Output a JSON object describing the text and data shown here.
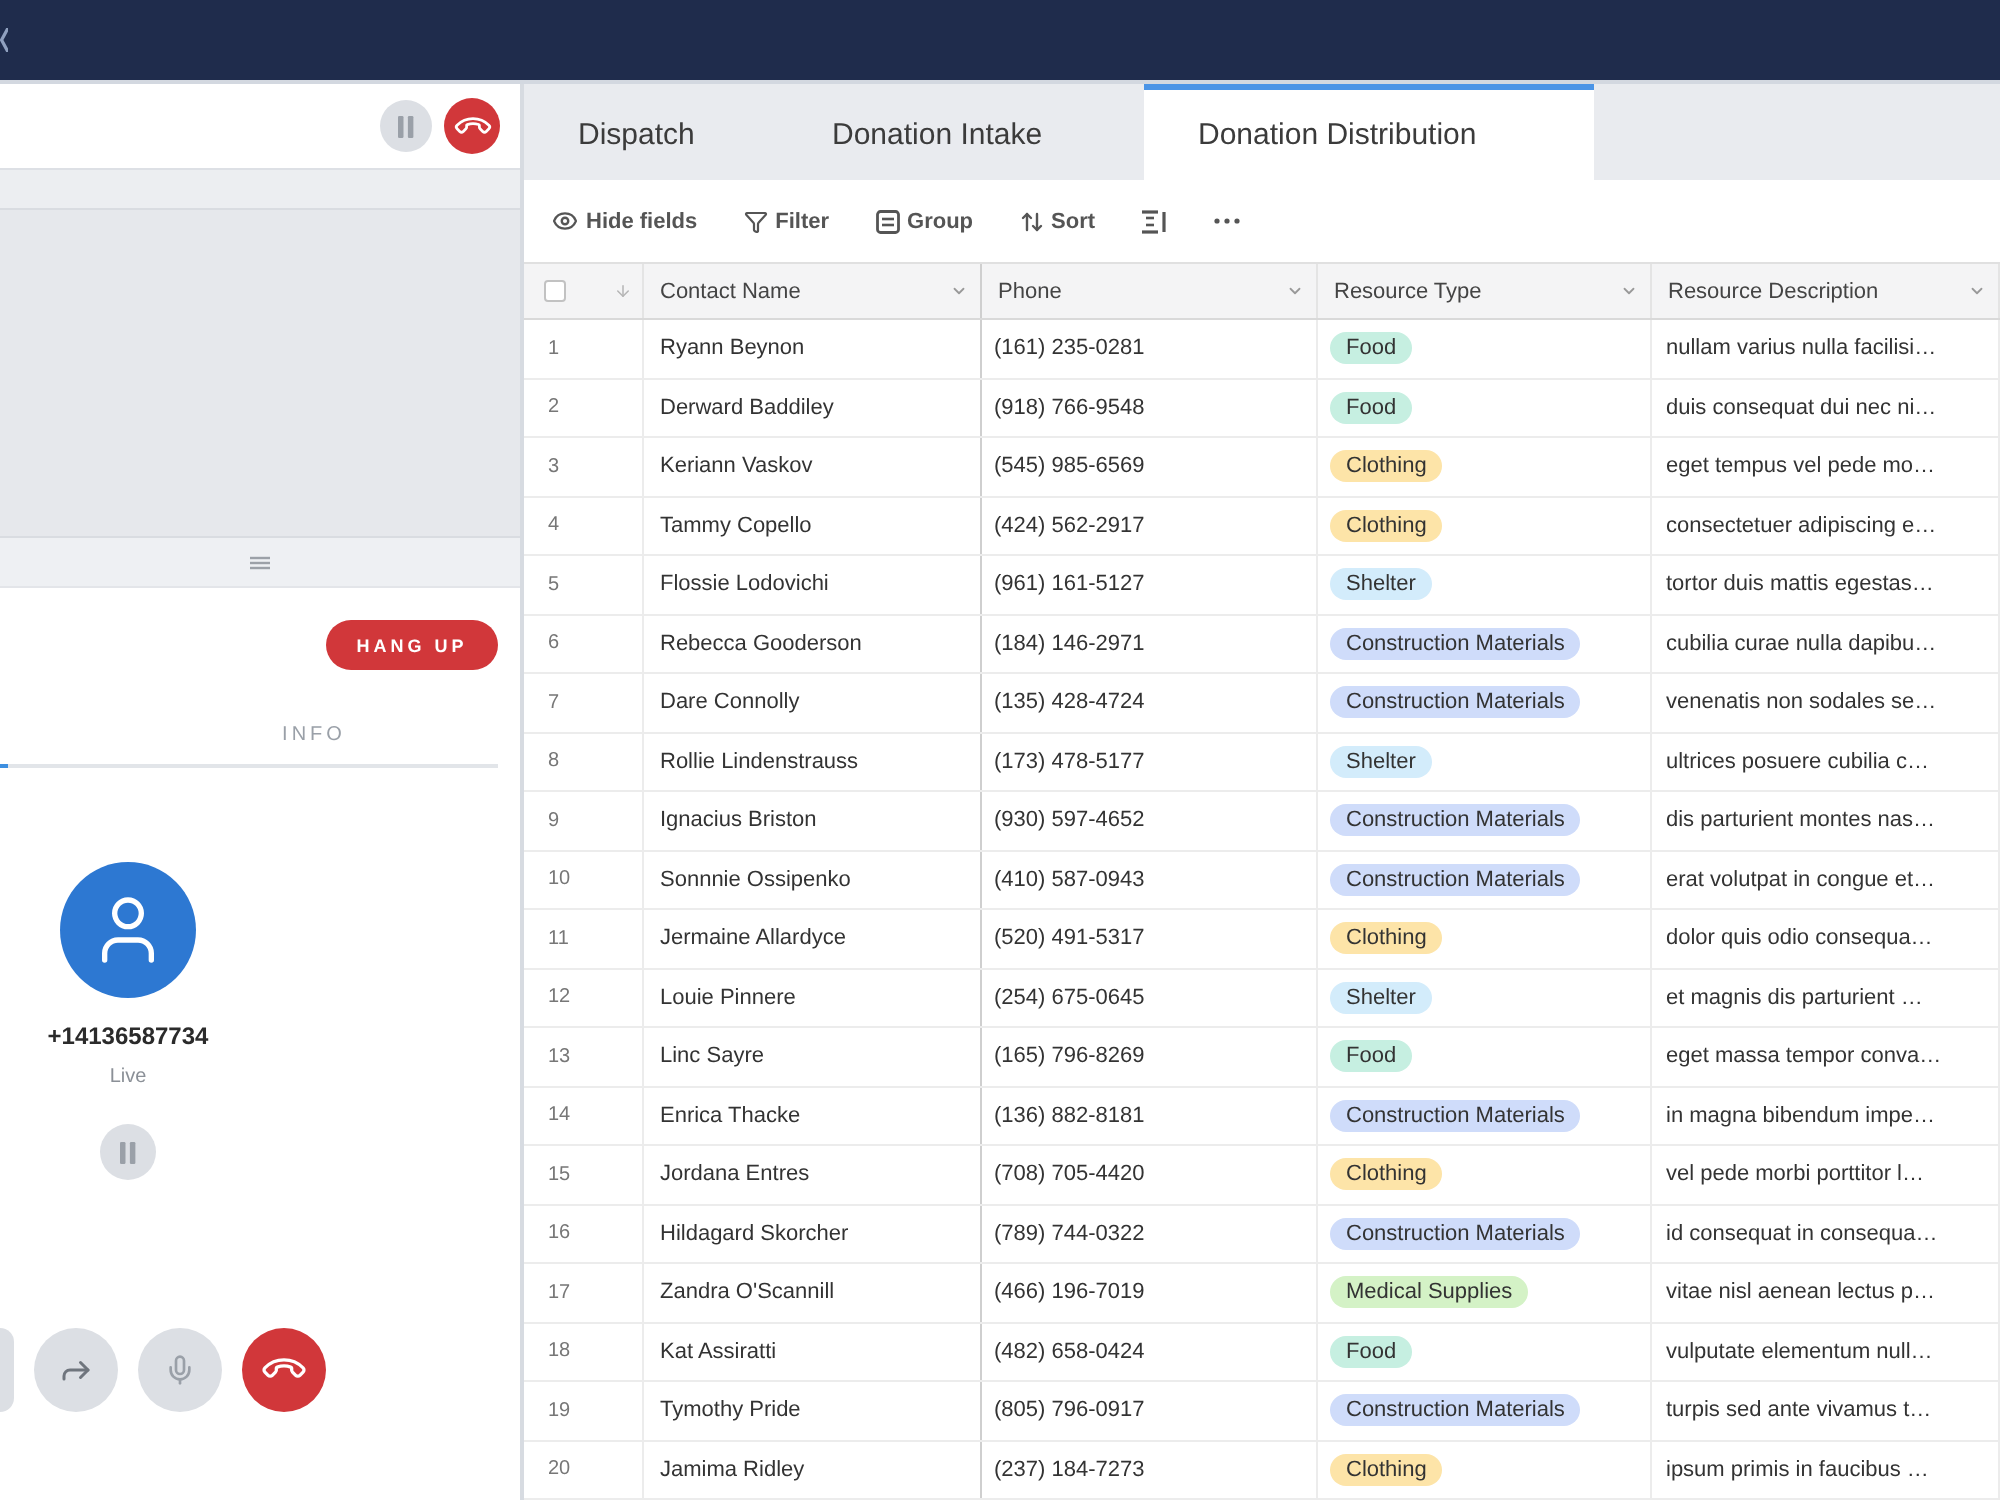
{
  "call_panel": {
    "hang_up_button": "HANG UP",
    "tabs": [
      {
        "selected": true
      },
      {
        "label": "INFO",
        "selected": false
      }
    ],
    "caller": {
      "number": "+14136587734",
      "status": "Live"
    }
  },
  "views": {
    "tabs": [
      {
        "label": "Dispatch",
        "selected": false
      },
      {
        "label": "Donation Intake",
        "selected": false
      },
      {
        "label": "Donation Distribution",
        "selected": true
      }
    ]
  },
  "toolbar": [
    {
      "kind": "hide",
      "label": "Hide fields"
    },
    {
      "kind": "filter",
      "label": "Filter"
    },
    {
      "kind": "group",
      "label": "Group"
    },
    {
      "kind": "sort",
      "label": "Sort"
    },
    {
      "kind": "row_height"
    },
    {
      "kind": "more"
    }
  ],
  "table": {
    "select_all": {
      "checked": false
    },
    "columns": [
      "Contact Name",
      "Phone",
      "Resource Type",
      "Resource Description"
    ],
    "rows": [
      {
        "number": "1",
        "contact_name": "Ryann Beynon",
        "phone": "(161) 235-0281",
        "resource_type": {
          "label": "Food",
          "color": "#c6efe1"
        },
        "resource_description": "nullam varius nulla facilisi…"
      },
      {
        "number": "2",
        "contact_name": "Derward Baddiley",
        "phone": "(918) 766-9548",
        "resource_type": {
          "label": "Food",
          "color": "#c6efe1"
        },
        "resource_description": "duis consequat dui nec ni…"
      },
      {
        "number": "3",
        "contact_name": "Keriann Vaskov",
        "phone": "(545) 985-6569",
        "resource_type": {
          "label": "Clothing",
          "color": "#fde4a8"
        },
        "resource_description": "eget tempus vel pede mo…"
      },
      {
        "number": "4",
        "contact_name": "Tammy Copello",
        "phone": "(424) 562-2917",
        "resource_type": {
          "label": "Clothing",
          "color": "#fde4a8"
        },
        "resource_description": "consectetuer adipiscing e…"
      },
      {
        "number": "5",
        "contact_name": "Flossie Lodovichi",
        "phone": "(961) 161-5127",
        "resource_type": {
          "label": "Shelter",
          "color": "#d3ecfb"
        },
        "resource_description": "tortor duis mattis egestas…"
      },
      {
        "number": "6",
        "contact_name": "Rebecca Gooderson",
        "phone": "(184) 146-2971",
        "resource_type": {
          "label": "Construction Materials",
          "color": "#cfdcfa"
        },
        "resource_description": "cubilia curae nulla dapibu…"
      },
      {
        "number": "7",
        "contact_name": "Dare Connolly",
        "phone": "(135) 428-4724",
        "resource_type": {
          "label": "Construction Materials",
          "color": "#cfdcfa"
        },
        "resource_description": "venenatis non sodales se…"
      },
      {
        "number": "8",
        "contact_name": "Rollie Lindenstrauss",
        "phone": "(173) 478-5177",
        "resource_type": {
          "label": "Shelter",
          "color": "#d3ecfb"
        },
        "resource_description": "ultrices posuere cubilia c…"
      },
      {
        "number": "9",
        "contact_name": "Ignacius Briston",
        "phone": "(930) 597-4652",
        "resource_type": {
          "label": "Construction Materials",
          "color": "#cfdcfa"
        },
        "resource_description": "dis parturient montes nas…"
      },
      {
        "number": "10",
        "contact_name": "Sonnnie Ossipenko",
        "phone": "(410) 587-0943",
        "resource_type": {
          "label": "Construction Materials",
          "color": "#cfdcfa"
        },
        "resource_description": "erat volutpat in congue et…"
      },
      {
        "number": "11",
        "contact_name": "Jermaine Allardyce",
        "phone": "(520) 491-5317",
        "resource_type": {
          "label": "Clothing",
          "color": "#fde4a8"
        },
        "resource_description": "dolor quis odio consequa…"
      },
      {
        "number": "12",
        "contact_name": "Louie Pinnere",
        "phone": "(254) 675-0645",
        "resource_type": {
          "label": "Shelter",
          "color": "#d3ecfb"
        },
        "resource_description": "et magnis dis parturient …"
      },
      {
        "number": "13",
        "contact_name": "Linc Sayre",
        "phone": "(165) 796-8269",
        "resource_type": {
          "label": "Food",
          "color": "#c6efe1"
        },
        "resource_description": "eget massa tempor conva…"
      },
      {
        "number": "14",
        "contact_name": "Enrica Thacke",
        "phone": "(136) 882-8181",
        "resource_type": {
          "label": "Construction Materials",
          "color": "#cfdcfa"
        },
        "resource_description": "in magna bibendum impe…"
      },
      {
        "number": "15",
        "contact_name": "Jordana Entres",
        "phone": "(708) 705-4420",
        "resource_type": {
          "label": "Clothing",
          "color": "#fde4a8"
        },
        "resource_description": "vel pede morbi porttitor l…"
      },
      {
        "number": "16",
        "contact_name": "Hildagard Skorcher",
        "phone": "(789) 744-0322",
        "resource_type": {
          "label": "Construction Materials",
          "color": "#cfdcfa"
        },
        "resource_description": "id consequat in consequa…"
      },
      {
        "number": "17",
        "contact_name": "Zandra O'Scannill",
        "phone": "(466) 196-7019",
        "resource_type": {
          "label": "Medical Supplies",
          "color": "#d4f2c6"
        },
        "resource_description": "vitae nisl aenean lectus p…"
      },
      {
        "number": "18",
        "contact_name": "Kat Assiratti",
        "phone": "(482) 658-0424",
        "resource_type": {
          "label": "Food",
          "color": "#c6efe1"
        },
        "resource_description": "vulputate elementum null…"
      },
      {
        "number": "19",
        "contact_name": "Tymothy Pride",
        "phone": "(805) 796-0917",
        "resource_type": {
          "label": "Construction Materials",
          "color": "#cfdcfa"
        },
        "resource_description": "turpis sed ante vivamus t…"
      },
      {
        "number": "20",
        "contact_name": "Jamima Ridley",
        "phone": "(237) 184-7273",
        "resource_type": {
          "label": "Clothing",
          "color": "#fde4a8"
        },
        "resource_description": "ipsum primis in faucibus …"
      }
    ]
  }
}
